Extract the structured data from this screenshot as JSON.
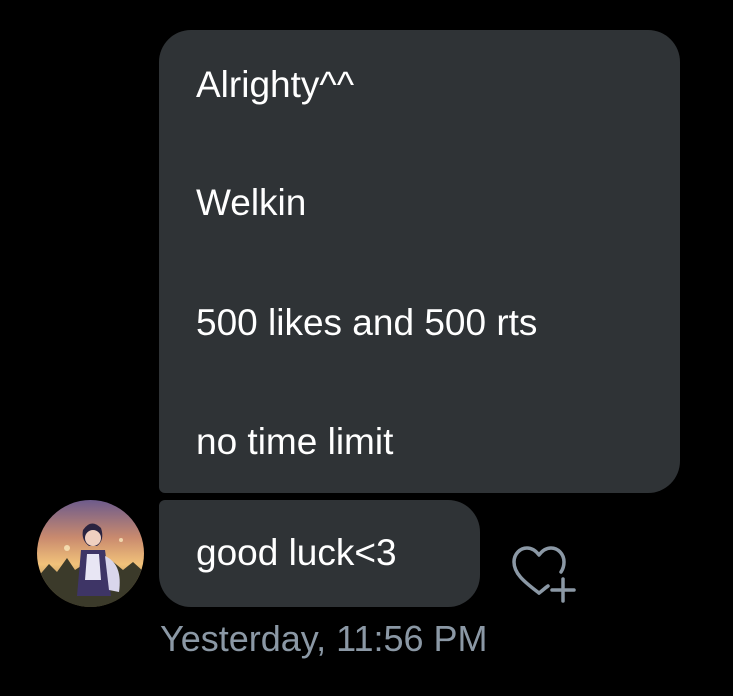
{
  "messages": [
    {
      "lines": [
        "Alrighty^^",
        "Welkin",
        "500 likes and 500 rts",
        "no time limit"
      ]
    },
    {
      "lines": [
        "good luck<3"
      ]
    }
  ],
  "timestamp": "Yesterday, 11:56 PM",
  "icons": {
    "reaction": "heart-plus-icon",
    "avatar": "avatar"
  },
  "colors": {
    "background": "#000000",
    "bubble": "#2f3336",
    "text": "#ffffff",
    "timestamp": "#8b98a5"
  }
}
